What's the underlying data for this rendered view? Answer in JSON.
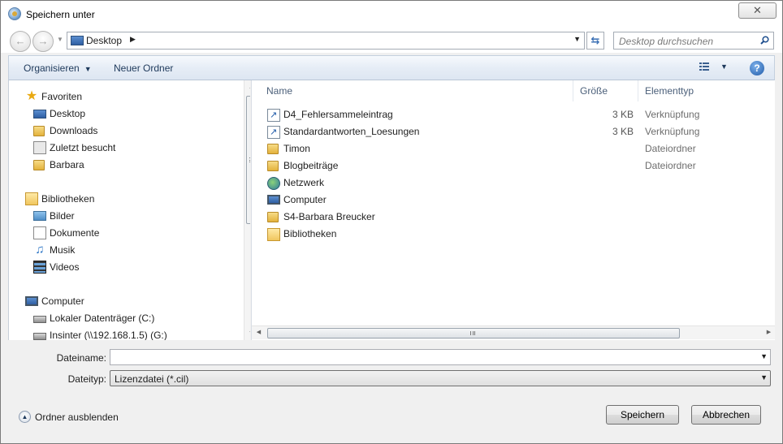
{
  "window": {
    "title": "Speichern unter",
    "close_label": "✕"
  },
  "nav": {
    "address_location": "Desktop",
    "search_placeholder": "Desktop durchsuchen"
  },
  "toolbar": {
    "organize_label": "Organisieren",
    "new_folder_label": "Neuer Ordner",
    "help_label": "?"
  },
  "sidebar": {
    "items": [
      {
        "label": "Favoriten",
        "icon": "star-icon"
      },
      {
        "label": "Desktop",
        "icon": "desktop-icon"
      },
      {
        "label": "Downloads",
        "icon": "downloads-folder-icon"
      },
      {
        "label": "Zuletzt besucht",
        "icon": "recent-places-icon"
      },
      {
        "label": "Barbara",
        "icon": "user-folder-icon"
      },
      {
        "label": "Bibliotheken",
        "icon": "libraries-icon"
      },
      {
        "label": "Bilder",
        "icon": "pictures-icon"
      },
      {
        "label": "Dokumente",
        "icon": "documents-icon"
      },
      {
        "label": "Musik",
        "icon": "music-icon"
      },
      {
        "label": "Videos",
        "icon": "videos-icon"
      },
      {
        "label": "Computer",
        "icon": "computer-icon"
      },
      {
        "label": "Lokaler Datenträger (C:)",
        "icon": "local-drive-icon"
      },
      {
        "label": "Insinter (\\\\192.168.1.5) (G:)",
        "icon": "network-drive-icon"
      }
    ]
  },
  "filelist": {
    "columns": {
      "name": "Name",
      "size": "Größe",
      "type": "Elementtyp"
    },
    "rows": [
      {
        "name": "D4_Fehlersammeleintrag",
        "size": "3 KB",
        "type": "Verknüpfung",
        "icon": "shortcut-icon"
      },
      {
        "name": "Standardantworten_Loesungen",
        "size": "3 KB",
        "type": "Verknüpfung",
        "icon": "shortcut-icon"
      },
      {
        "name": "Timon",
        "size": "",
        "type": "Dateiordner",
        "icon": "folder-icon"
      },
      {
        "name": "Blogbeiträge",
        "size": "",
        "type": "Dateiordner",
        "icon": "folder-icon"
      },
      {
        "name": "Netzwerk",
        "size": "",
        "type": "",
        "icon": "network-icon"
      },
      {
        "name": "Computer",
        "size": "",
        "type": "",
        "icon": "computer-icon"
      },
      {
        "name": "S4-Barbara Breucker",
        "size": "",
        "type": "",
        "icon": "user-folder-icon"
      },
      {
        "name": "Bibliotheken",
        "size": "",
        "type": "",
        "icon": "libraries-icon"
      }
    ]
  },
  "form": {
    "filename_label": "Dateiname:",
    "filename_value": "",
    "filetype_label": "Dateityp:",
    "filetype_value": "Lizenzdatei (*.cil)"
  },
  "footer": {
    "hide_folders_label": "Ordner ausblenden",
    "save_label": "Speichern",
    "cancel_label": "Abbrechen"
  }
}
